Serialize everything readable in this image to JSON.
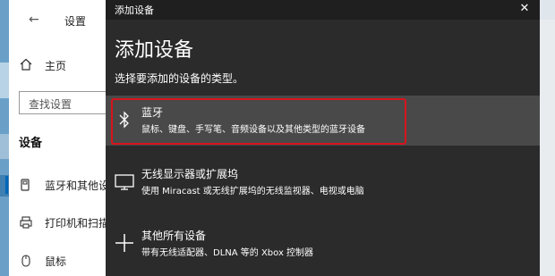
{
  "colors": {
    "dialog_bg": "#2b2b2b",
    "selected_bg": "#494949",
    "accent": "#0067b8",
    "highlight": "#d8141c"
  },
  "settings": {
    "title": "设置",
    "home_label": "主页",
    "search_placeholder": "查找设置",
    "section_title": "设备",
    "nav_items": [
      {
        "label": "蓝牙和其他设",
        "icon": "devices-icon",
        "active": true
      },
      {
        "label": "打印机和扫描",
        "icon": "printer-icon",
        "active": false
      },
      {
        "label": "鼠标",
        "icon": "mouse-icon",
        "active": false
      }
    ]
  },
  "dialog": {
    "titlebar": "添加设备",
    "heading": "添加设备",
    "subheading": "选择要添加的设备的类型。",
    "options": [
      {
        "title": "蓝牙",
        "desc": "鼠标、键盘、手写笔、音频设备以及其他类型的蓝牙设备",
        "icon": "bluetooth-icon"
      },
      {
        "title": "无线显示器或扩展坞",
        "desc": "使用 Miracast 或无线扩展坞的无线监视器、电视或电脑",
        "icon": "monitor-icon"
      },
      {
        "title": "其他所有设备",
        "desc": "带有无线适配器、DLNA 等的 Xbox 控制器",
        "icon": "plus-icon"
      }
    ]
  }
}
